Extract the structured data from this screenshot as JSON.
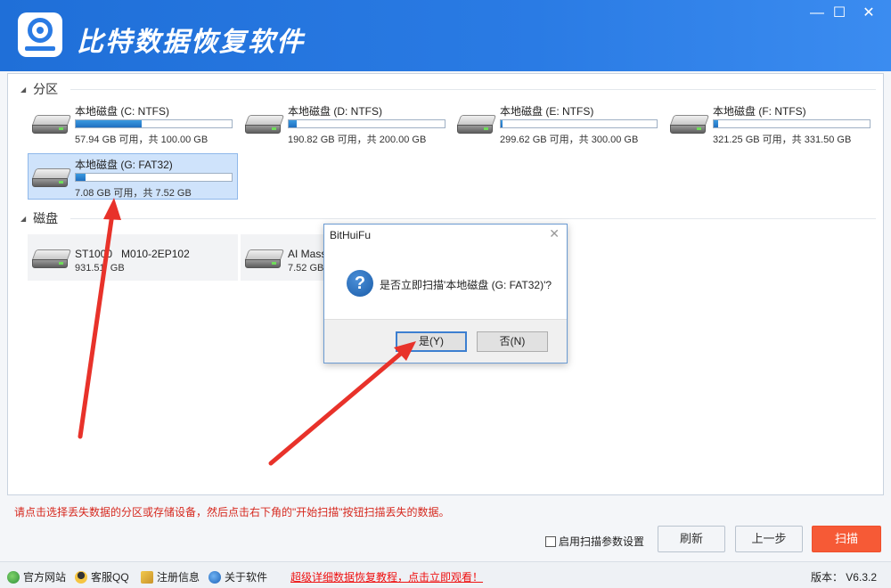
{
  "app": {
    "title": "比特数据恢复软件"
  },
  "window_controls": {
    "minimize": "—",
    "maximize": "☐",
    "close": "✕"
  },
  "sections": {
    "partitions": "分区",
    "disks": "磁盘"
  },
  "partitions": [
    {
      "name": "本地磁盘 (C: NTFS)",
      "info": "57.94 GB 可用，共 100.00 GB",
      "used_fraction": 0.42
    },
    {
      "name": "本地磁盘 (D: NTFS)",
      "info": "190.82 GB 可用，共 200.00 GB",
      "used_fraction": 0.05
    },
    {
      "name": "本地磁盘 (E: NTFS)",
      "info": "299.62 GB 可用，共 300.00 GB",
      "used_fraction": 0.01
    },
    {
      "name": "本地磁盘 (F: NTFS)",
      "info": "321.25 GB 可用，共 331.50 GB",
      "used_fraction": 0.03
    },
    {
      "name": "本地磁盘 (G: FAT32)",
      "info": "7.08 GB 可用，共 7.52 GB",
      "used_fraction": 0.06
    }
  ],
  "disks": [
    {
      "name": "ST1000",
      "name_tail": "M010-2EP102",
      "info": "931.51",
      "info_tail": "GB"
    },
    {
      "name": "AI Mass S",
      "info": "7.52 GB"
    }
  ],
  "dialog": {
    "title": "BitHuiFu",
    "close": "✕",
    "icon": "question-icon",
    "message": "是否立即扫描'本地磁盘 (G: FAT32)'?",
    "yes": "是(Y)",
    "no": "否(N)"
  },
  "hint": "请点击选择丢失数据的分区或存储设备，然后点击右下角的\"开始扫描\"按钮扫描丢失的数据。",
  "options": {
    "scan_params": "启用扫描参数设置"
  },
  "buttons": {
    "refresh": "刷新",
    "back": "上一步",
    "scan": "扫描"
  },
  "statusbar": {
    "website": "官方网站",
    "support": "客服QQ",
    "register": "注册信息",
    "about": "关于软件",
    "tutorial_link": "超级详细数据恢复教程，点击立即观看！",
    "version": "版本：  V6.3.2"
  },
  "colors": {
    "accent": "#2a7be4",
    "primary_button": "#f65a36",
    "hint_text": "#d6281e",
    "arrow": "#e8322a"
  }
}
